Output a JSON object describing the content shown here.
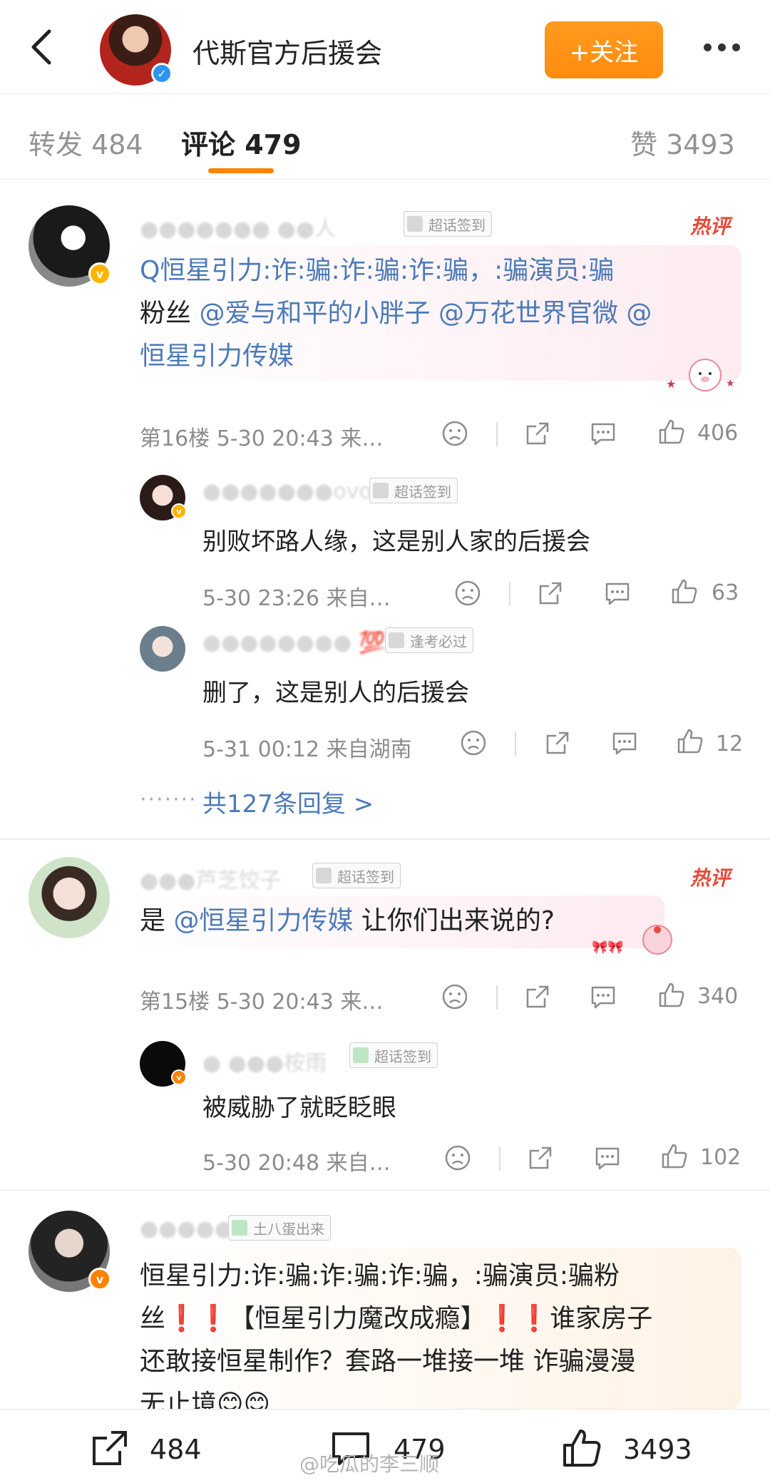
{
  "header": {
    "title": "代斯官方后援会",
    "follow_label": "+关注"
  },
  "tabs": {
    "repost": "转发 484",
    "comments": "评论 479",
    "likes": "赞 3493"
  },
  "comments": [
    {
      "tag": "超话签到",
      "hot_label": "热评",
      "text_parts": [
        "Q恒星引力:诈:骗:诈:骗:诈:骗，:骗演员:骗",
        "粉丝",
        "@爱与和平的小胖子",
        "@万花世界官微",
        "@",
        "恒星引力传媒"
      ],
      "meta": "第16楼 5-30 20:43 来…",
      "likes": "406",
      "replies": [
        {
          "tag": "超话签到",
          "text": "别败坏路人缘，这是别人家的后援会",
          "meta": "5-30 23:26 来自…",
          "likes": "63"
        },
        {
          "tag": "逢考必过",
          "text": "删了，这是别人的后援会",
          "meta": "5-31 00:12 来自湖南",
          "likes": "12"
        }
      ],
      "more_replies": "共127条回复 >"
    },
    {
      "tag": "超话签到",
      "hot_label": "热评",
      "text_parts": [
        "是 ",
        "@恒星引力传媒",
        " 让你们出来说的?"
      ],
      "meta": "第15楼 5-30 20:43 来…",
      "likes": "340",
      "replies": [
        {
          "tag": "超话签到",
          "text": "被威胁了就眨眨眼",
          "meta": "5-30 20:48 来自…",
          "likes": "102"
        }
      ]
    },
    {
      "tag": "土八蛋出来",
      "text_lines": [
        "恒星引力:诈:骗:诈:骗:诈:骗，:骗演员:骗粉",
        "丝❗❗【恒星引力魔改成瘾】❗❗谁家房子",
        "还敢接恒星制作？套路一堆接一堆 诈骗漫漫",
        "无止境😊😊"
      ]
    }
  ],
  "bottom_bar": {
    "repost_count": "484",
    "comment_count": "479",
    "like_count": "3493",
    "watermark": "@吃瓜的李三顺"
  },
  "icons": {
    "back": "chevron-left-icon",
    "more": "more-dots-icon",
    "sad": "sad-face-icon",
    "share": "share-icon",
    "comment": "comment-icon",
    "like": "thumbs-up-icon"
  },
  "colors": {
    "accent": "#ff8200",
    "link": "#4d7ab8",
    "hot": "#e64a3b",
    "verified": "#2b95f0"
  }
}
